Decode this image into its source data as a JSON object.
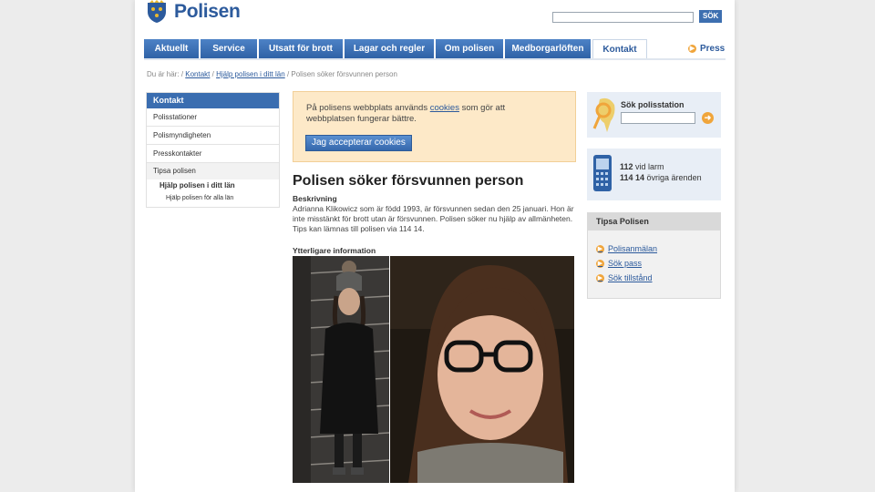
{
  "header": {
    "logo_text": "Polisen",
    "search_button": "SÖK"
  },
  "nav": {
    "tabs": [
      "Aktuellt",
      "Service",
      "Utsatt för brott",
      "Lagar och regler",
      "Om polisen",
      "Medborgarlöften",
      "Kontakt"
    ],
    "active_tab": "Kontakt",
    "press_label": "Press"
  },
  "breadcrumb": {
    "prefix": "Du är här:",
    "items": [
      "Kontakt",
      "Hjälp polisen i ditt län"
    ],
    "current": "Polisen söker försvunnen person"
  },
  "sidebar": {
    "heading": "Kontakt",
    "items": [
      "Polisstationer",
      "Polismyndigheten",
      "Presskontakter",
      "Tipsa polisen"
    ],
    "sub_item": "Hjälp polisen i ditt län",
    "sub_sub_item": "Hjälp polisen för alla län"
  },
  "cookie": {
    "text_before": "På polisens webbplats används ",
    "link": "cookies",
    "text_after": " som gör att webbplatsen fungerar bättre.",
    "button": "Jag accepterar cookies"
  },
  "article": {
    "title": "Polisen söker försvunnen person",
    "desc_label": "Beskrivning",
    "description": "Adrianna Klikowicz som är född 1993, är försvunnen sedan den 25 januari. Hon är inte misstänkt för brott utan är försvunnen. Polisen söker nu hjälp av allmänheten. Tips kan lämnas till polisen via 114 14.",
    "more_label": "Ytterligare information"
  },
  "right": {
    "station_label": "Sök polisstation",
    "phone_line1_num": "112",
    "phone_line1_text": " vid larm",
    "phone_line2_num": "114 14",
    "phone_line2_text": " övriga ärenden",
    "tips_heading": "Tipsa Polisen",
    "tips_links": [
      "Polisanmälan",
      "Sök pass",
      "Sök tillstånd"
    ]
  }
}
